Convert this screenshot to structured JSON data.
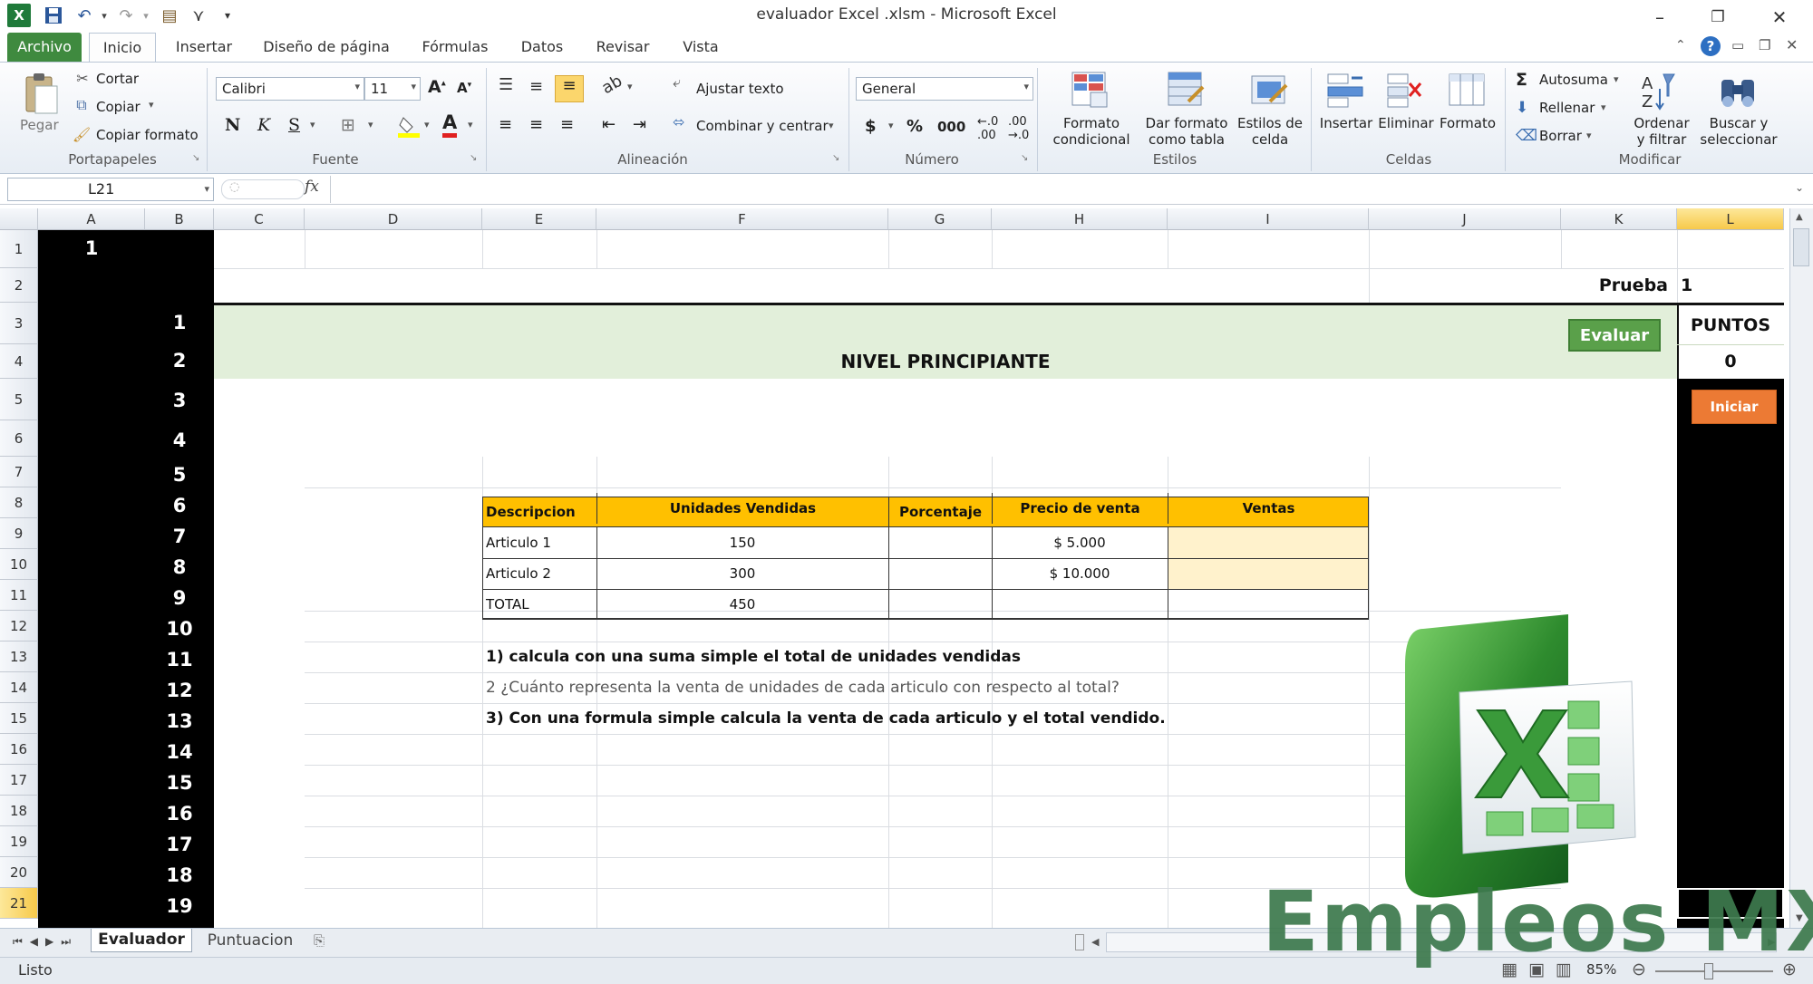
{
  "window": {
    "title": "evaluador Excel .xlsm  -  Microsoft Excel"
  },
  "tabs": [
    "Archivo",
    "Inicio",
    "Insertar",
    "Diseño de página",
    "Fórmulas",
    "Datos",
    "Revisar",
    "Vista"
  ],
  "ribbon": {
    "clipboard": {
      "paste": "Pegar",
      "cut": "Cortar",
      "copy": "Copiar",
      "format_painter": "Copiar formato",
      "label": "Portapapeles"
    },
    "font": {
      "name": "Calibri",
      "size": "11",
      "bold": "N",
      "italic": "K",
      "underline": "S",
      "color_letter": "A",
      "label": "Fuente"
    },
    "alignment": {
      "wrap": "Ajustar texto",
      "merge": "Combinar y centrar",
      "label": "Alineación"
    },
    "number": {
      "format": "General",
      "currency": "$",
      "percent": "%",
      "thousands": "000",
      "label": "Número"
    },
    "styles": {
      "conditional_1": "Formato",
      "conditional_2": "condicional",
      "table_1": "Dar formato",
      "table_2": "como tabla",
      "cell_1": "Estilos de",
      "cell_2": "celda",
      "label": "Estilos"
    },
    "cells": {
      "insert": "Insertar",
      "delete": "Eliminar",
      "format": "Formato",
      "label": "Celdas"
    },
    "editing": {
      "autosum": "Autosuma",
      "fill": "Rellenar",
      "clear": "Borrar",
      "sort_1": "Ordenar",
      "sort_2": "y filtrar",
      "find_1": "Buscar y",
      "find_2": "seleccionar",
      "label": "Modificar"
    }
  },
  "formula_bar": {
    "namebox": "L21",
    "fx": "fx",
    "value": ""
  },
  "columns": [
    "A",
    "B",
    "C",
    "D",
    "E",
    "F",
    "G",
    "H",
    "I",
    "J",
    "K",
    "L"
  ],
  "rows": [
    "1",
    "2",
    "3",
    "4",
    "5",
    "6",
    "7",
    "8",
    "9",
    "10",
    "11",
    "12",
    "13",
    "14",
    "15",
    "16",
    "17",
    "18",
    "19",
    "20",
    "21"
  ],
  "sheet": {
    "a1": "1",
    "black_numbers": [
      "1",
      "2",
      "3",
      "4",
      "5",
      "6",
      "7",
      "8",
      "9",
      "10",
      "11",
      "12",
      "13",
      "14",
      "15",
      "16",
      "17",
      "18",
      "19"
    ],
    "prueba_label": "Prueba",
    "prueba_value": "1",
    "title": "NIVEL PRINCIPIANTE",
    "evaluate_button": "Evaluar",
    "points_label": "PUNTOS",
    "points_value": "0",
    "start_button": "Iniciar",
    "table": {
      "headers": [
        "Descripcion",
        "Unidades Vendidas",
        "Porcentaje",
        "Precio de venta",
        "Ventas"
      ],
      "rows": [
        [
          "Articulo 1",
          "150",
          "",
          "$ 5.000",
          ""
        ],
        [
          "Articulo 2",
          "300",
          "",
          "$ 10.000",
          ""
        ],
        [
          "TOTAL",
          "450",
          "",
          "",
          ""
        ]
      ]
    },
    "questions": [
      "1) calcula con una suma simple el total de unidades vendidas",
      "2 ¿Cuánto representa la venta de unidades de cada articulo con respecto al total?",
      "3) Con una formula simple calcula la venta de cada articulo y el total vendido."
    ]
  },
  "sheet_tabs": [
    "Evaluador",
    "Puntuacion"
  ],
  "status": {
    "ready": "Listo",
    "zoom": "85%"
  },
  "watermark": "Empleos MX",
  "colors": {
    "excel_green": "#3f8a3f",
    "header_orange": "#ffc000",
    "light_green_band": "#e2efda",
    "input_yellow": "#fff2cc",
    "start_orange": "#ec7a34"
  }
}
